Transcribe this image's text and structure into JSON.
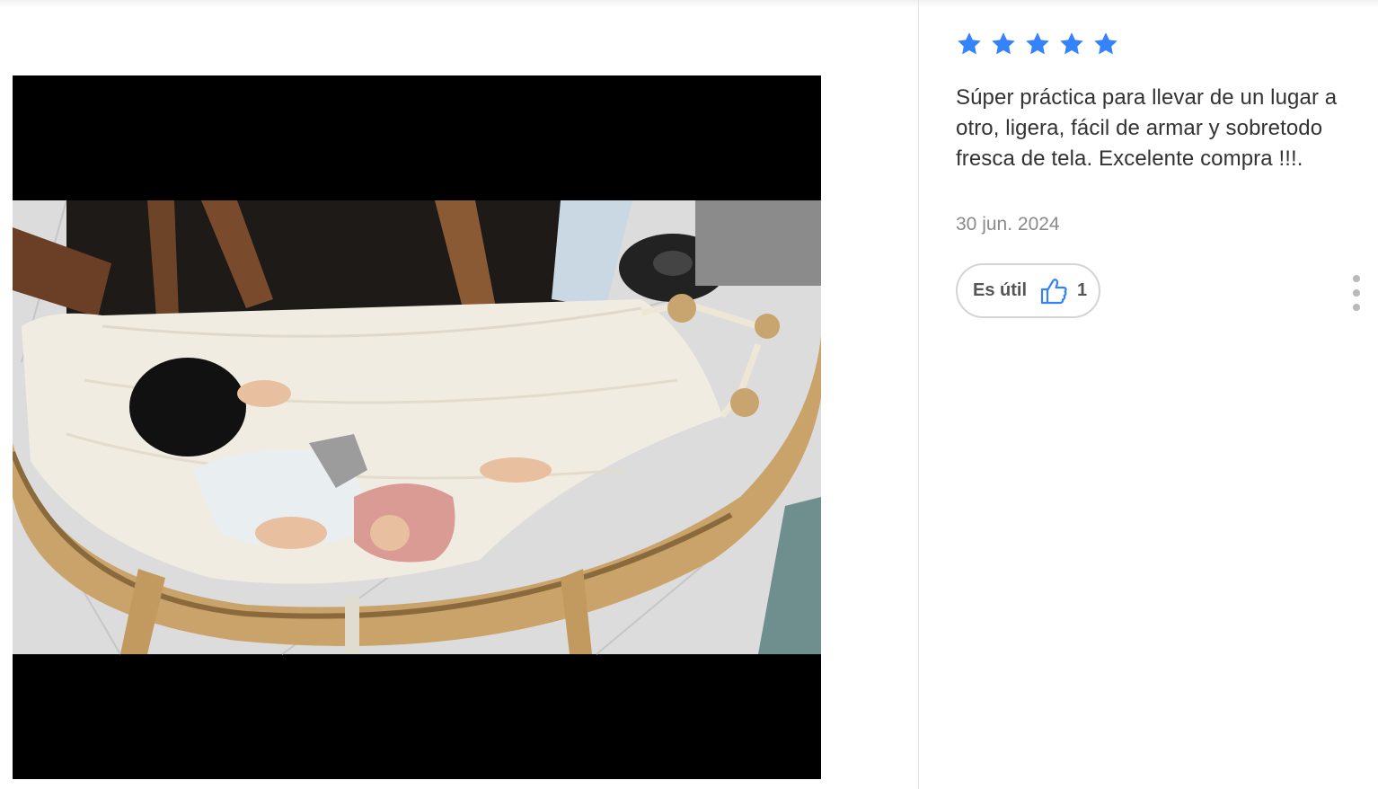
{
  "review": {
    "rating": 5,
    "max_rating": 5,
    "text": "Súper práctica para llevar de un lugar a otro, ligera, fácil de armar y sobretodo fresca de tela. Excelente compra !!!.",
    "date": "30 jun. 2024",
    "useful_label": "Es útil",
    "useful_count": "1"
  },
  "colors": {
    "star": "#3483fa",
    "thumb": "#3483fa",
    "text": "#333333",
    "date": "#8a8a8a"
  },
  "icons": {
    "star": "star-icon",
    "thumb": "thumbs-up-icon",
    "more": "more-vertical-icon"
  }
}
